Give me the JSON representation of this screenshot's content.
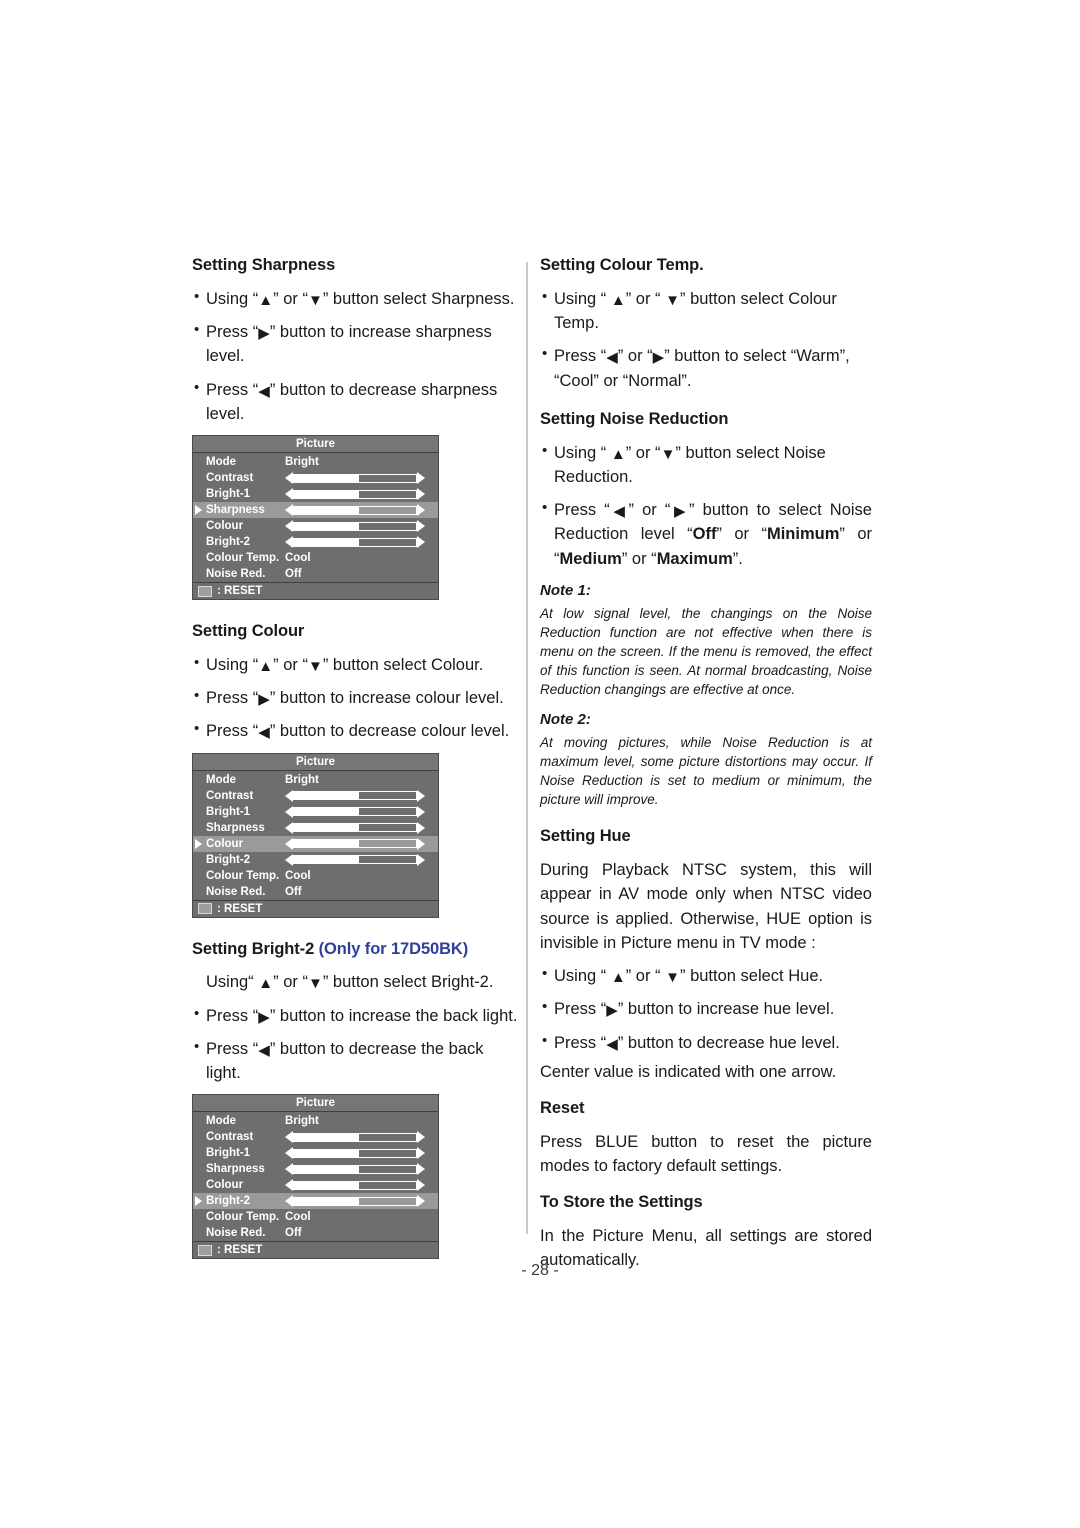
{
  "page": {
    "number_label": "- 28 -"
  },
  "icons": {
    "up": "▲",
    "down": "▼",
    "left": "◀",
    "right": "▶",
    "bullet": "•"
  },
  "left_column": {
    "sharpness": {
      "heading": "Setting Sharpness",
      "bullets": [
        {
          "pre": "Using “",
          "mid": "” or “",
          "post": "” button select Sharpness.",
          "icons": [
            "up",
            "down"
          ]
        },
        {
          "pre": "Press “",
          "post": "” button to increase sharpness level.",
          "icons": [
            "right"
          ]
        },
        {
          "pre": "Press “",
          "post": "” button to decrease sharpness level.",
          "icons": [
            "left"
          ]
        }
      ]
    },
    "colour": {
      "heading": "Setting Colour",
      "bullets": [
        {
          "pre": "Using “",
          "mid": "” or “",
          "post": "” button select Colour.",
          "icons": [
            "up",
            "down"
          ]
        },
        {
          "pre": "Press “",
          "post": "” button to increase colour level.",
          "icons": [
            "right"
          ]
        },
        {
          "pre": "Press “",
          "post": "” button to decrease colour level.",
          "icons": [
            "left"
          ]
        }
      ]
    },
    "bright2": {
      "heading_main": "Setting Bright-2 ",
      "heading_only": "(Only for 17D50BK)",
      "bullets": [
        {
          "pre": "Using“ ",
          "mid": "” or “",
          "post": "” button select Bright-2.",
          "icons": [
            "up",
            "down"
          ],
          "nodot": true
        },
        {
          "pre": "Press “",
          "post": "” button to increase the back light.",
          "icons": [
            "right"
          ]
        },
        {
          "pre": "Press “",
          "post": "” button to decrease the back light.",
          "icons": [
            "left"
          ]
        }
      ]
    }
  },
  "right_column": {
    "colour_temp": {
      "heading": "Setting Colour Temp.",
      "bullets": [
        {
          "pre": "Using “ ",
          "mid": "” or “ ",
          "post": "” button select Colour Temp.",
          "icons": [
            "up",
            "down"
          ]
        },
        {
          "pre": "Press “",
          "mid": "” or “",
          "post": "”  button to select “Warm”, “Cool” or “Normal”.",
          "icons": [
            "left",
            "right"
          ]
        }
      ]
    },
    "noise_reduction": {
      "heading": "Setting Noise Reduction",
      "bullet1": {
        "pre": "Using “ ",
        "mid": "” or “",
        "post": "” button select Noise Reduction.",
        "icons": [
          "up",
          "down"
        ]
      },
      "bullet2": {
        "pre": "Press “",
        "mid": "” or “",
        "seg1": "”  button to select Noise Reduction level “",
        "b1": "Off",
        "seg2": "” or “",
        "b2": "Minimum",
        "seg3": "” or “",
        "b3": "Medium",
        "seg4": "” or “",
        "b4": "Maximum",
        "seg5": "”.",
        "icons": [
          "left",
          "right"
        ]
      }
    },
    "note1": {
      "title": "Note  1:",
      "body": "At low signal level, the changings on the Noise Reduction function are not effective when there is menu on the screen. If the menu is removed, the effect of this function is seen. At normal broadcasting, Noise Reduction changings are effective at once."
    },
    "note2": {
      "title": "Note  2:",
      "body": "At moving pictures, while Noise Reduction is at maximum level, some picture distortions may occur. If Noise Reduction is set to medium or minimum, the picture will improve."
    },
    "hue": {
      "heading": "Setting Hue",
      "intro": "During Playback NTSC system, this will appear in AV mode only when NTSC video source is applied. Otherwise, HUE option is invisible in Picture menu in TV mode :",
      "bullets": [
        {
          "pre": "Using “ ",
          "mid": "” or “ ",
          "post": "” button select Hue.",
          "icons": [
            "up",
            "down"
          ]
        },
        {
          "pre": "Press “",
          "post": "” button to increase hue level.",
          "icons": [
            "right"
          ]
        },
        {
          "pre": "Press “",
          "post": "” button to decrease hue level.",
          "icons": [
            "left"
          ]
        }
      ],
      "closing": "Center value is indicated with one arrow."
    },
    "reset": {
      "heading": "Reset",
      "body": "Press BLUE button to reset the picture modes to factory default settings."
    },
    "store": {
      "heading": "To Store the Settings",
      "body": "In the Picture Menu, all settings are stored automatically."
    }
  },
  "osd_menus": [
    {
      "title": "Picture",
      "selected": "Sharpness",
      "footer_label": ": RESET",
      "rows": [
        {
          "label": "Mode",
          "type": "text",
          "value": "Bright"
        },
        {
          "label": "Contrast",
          "type": "slider",
          "fill": 53
        },
        {
          "label": "Bright-1",
          "type": "slider",
          "fill": 53
        },
        {
          "label": "Sharpness",
          "type": "slider",
          "fill": 53
        },
        {
          "label": "Colour",
          "type": "slider",
          "fill": 53
        },
        {
          "label": "Bright-2",
          "type": "slider",
          "fill": 53
        },
        {
          "label": "Colour Temp.",
          "type": "text",
          "value": "Cool"
        },
        {
          "label": "Noise Red.",
          "type": "text",
          "value": "Off"
        }
      ]
    },
    {
      "title": "Picture",
      "selected": "Colour",
      "footer_label": ": RESET",
      "rows": [
        {
          "label": "Mode",
          "type": "text",
          "value": "Bright"
        },
        {
          "label": "Contrast",
          "type": "slider",
          "fill": 53
        },
        {
          "label": "Bright-1",
          "type": "slider",
          "fill": 53
        },
        {
          "label": "Sharpness",
          "type": "slider",
          "fill": 53
        },
        {
          "label": "Colour",
          "type": "slider",
          "fill": 53
        },
        {
          "label": "Bright-2",
          "type": "slider",
          "fill": 53
        },
        {
          "label": "Colour Temp.",
          "type": "text",
          "value": "Cool"
        },
        {
          "label": "Noise Red.",
          "type": "text",
          "value": "Off"
        }
      ]
    },
    {
      "title": "Picture",
      "selected": "Bright-2",
      "footer_label": ": RESET",
      "rows": [
        {
          "label": "Mode",
          "type": "text",
          "value": "Bright"
        },
        {
          "label": "Contrast",
          "type": "slider",
          "fill": 53
        },
        {
          "label": "Bright-1",
          "type": "slider",
          "fill": 53
        },
        {
          "label": "Sharpness",
          "type": "slider",
          "fill": 53
        },
        {
          "label": "Colour",
          "type": "slider",
          "fill": 53
        },
        {
          "label": "Bright-2",
          "type": "slider",
          "fill": 53
        },
        {
          "label": "Colour Temp.",
          "type": "text",
          "value": "Cool"
        },
        {
          "label": "Noise Red.",
          "type": "text",
          "value": "Off"
        }
      ]
    }
  ]
}
